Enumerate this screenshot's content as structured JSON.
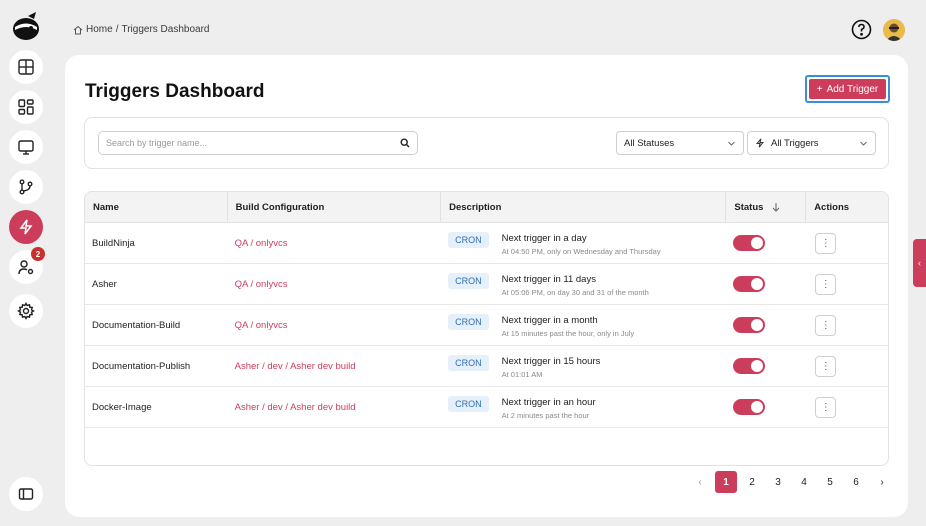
{
  "breadcrumb": {
    "home": "Home",
    "separator": "/",
    "current": "Triggers Dashboard"
  },
  "page": {
    "title": "Triggers Dashboard",
    "add_button": "Add Trigger"
  },
  "filters": {
    "search_placeholder": "Search by trigger name...",
    "status_select": "All Statuses",
    "trigger_select": "All Triggers"
  },
  "table": {
    "headers": {
      "name": "Name",
      "build": "Build Configuration",
      "description": "Description",
      "status": "Status",
      "actions": "Actions"
    },
    "rows": [
      {
        "name": "BuildNinja",
        "build": "QA / onlyvcs",
        "type": "CRON",
        "next": "Next trigger in a day",
        "schedule": "At 04:50 PM, only on Wednesday and Thursday",
        "enabled": true
      },
      {
        "name": "Asher",
        "build": "QA / onlyvcs",
        "type": "CRON",
        "next": "Next trigger in 11 days",
        "schedule": "At 05:06 PM, on day 30 and 31 of the month",
        "enabled": true
      },
      {
        "name": "Documentation-Build",
        "build": "QA / onlyvcs",
        "type": "CRON",
        "next": "Next trigger in a month",
        "schedule": "At 15 minutes past the hour, only in July",
        "enabled": true
      },
      {
        "name": "Documentation-Publish",
        "build": "Asher / dev / Asher dev build",
        "type": "CRON",
        "next": "Next trigger in 15 hours",
        "schedule": "At 01:01 AM",
        "enabled": true
      },
      {
        "name": "Docker-Image",
        "build": "Asher / dev / Asher dev build",
        "type": "CRON",
        "next": "Next trigger in an hour",
        "schedule": "At 2 minutes past the hour",
        "enabled": true
      }
    ],
    "action_glyph": "⋮"
  },
  "pagination": {
    "prev": "‹",
    "pages": [
      "1",
      "2",
      "3",
      "4",
      "5",
      "6"
    ],
    "current": "1",
    "next": "›"
  },
  "sidebar": {
    "notification_badge": "2"
  },
  "colors": {
    "accent": "#cc3d5c",
    "cron_text": "#2e6fb5",
    "cron_bg": "#e6f0fa",
    "focus_border": "#3a8fd9"
  }
}
